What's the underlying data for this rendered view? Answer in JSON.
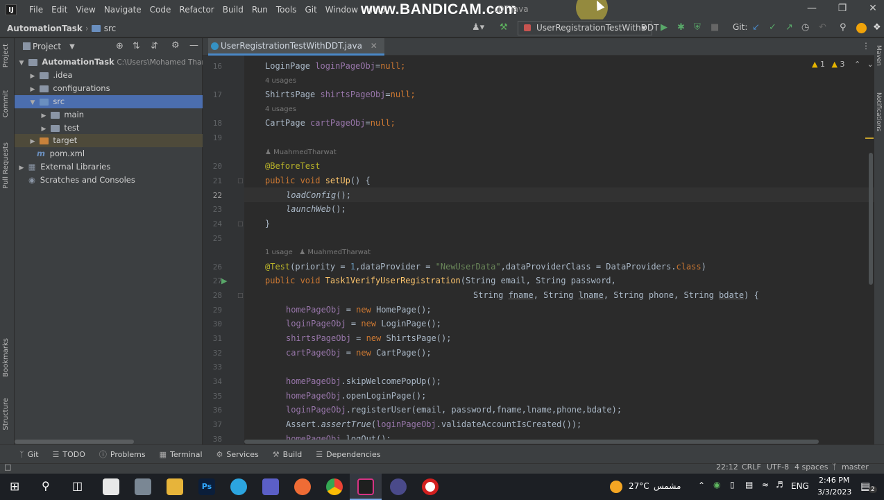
{
  "menubar": {
    "app_icon_label": "IJ",
    "items": [
      "File",
      "Edit",
      "View",
      "Navigate",
      "Code",
      "Refactor",
      "Build",
      "Run",
      "Tools",
      "Git",
      "Window",
      "Help"
    ],
    "watermark": "www.BANDICAM.com",
    "watermark_file": "...DT.java"
  },
  "navbar": {
    "project": "AutomationTask",
    "folder": "src",
    "run_config": "UserRegistrationTestWithDDT",
    "git_label": "Git:"
  },
  "project_panel": {
    "title": "Project",
    "root": "AutomationTask",
    "root_path": "C:\\Users\\Mohamed Tharwat",
    "items": [
      {
        "label": ".idea"
      },
      {
        "label": "configurations"
      },
      {
        "label": "src"
      },
      {
        "label": "main"
      },
      {
        "label": "test"
      },
      {
        "label": "target"
      },
      {
        "label": "pom.xml"
      },
      {
        "label": "External Libraries"
      },
      {
        "label": "Scratches and Consoles"
      }
    ]
  },
  "left_strip": [
    "Project",
    "Commit",
    "Pull Requests",
    "Bookmarks",
    "Structure"
  ],
  "right_strip": [
    "Maven",
    "Notifications"
  ],
  "editor": {
    "tab": "UserRegistrationTestWithDDT.java",
    "warnings": "1",
    "weak_warnings": "3",
    "line_numbers": [
      "16",
      "17",
      "18",
      "19",
      "20",
      "21",
      "22",
      "23",
      "24",
      "25",
      "26",
      "27",
      "28",
      "29",
      "30",
      "31",
      "32",
      "33",
      "34",
      "35",
      "36",
      "37",
      "38"
    ],
    "hints": {
      "usages4": "4 usages",
      "author": "MuahmedTharwat",
      "usage1": "1 usage"
    },
    "code": {
      "l16a": "LoginPage ",
      "l16b": "loginPageObj",
      "l16c": "=",
      "l16d": "null",
      "l16e": ";",
      "l17a": "ShirtsPage ",
      "l17b": "shirtsPageObj",
      "l17c": "=",
      "l17d": "null",
      "l17e": ";",
      "l18a": "CartPage ",
      "l18b": "cartPageObj",
      "l18c": "=",
      "l18d": "null",
      "l18e": ";",
      "l20": "@BeforeTest",
      "l21a": "public void ",
      "l21b": "setUp",
      "l21c": "() {",
      "l22a": "loadConfig",
      "l22b": "();",
      "l23a": "launchWeb",
      "l23b": "();",
      "l24": "}",
      "l26a": "@Test",
      "l26b": "(priority = ",
      "l26c": "1",
      "l26d": ",dataProvider = ",
      "l26e": "\"NewUserData\"",
      "l26f": ",dataProviderClass = DataProviders.",
      "l26g": "class",
      "l26h": ")",
      "l27a": "public void ",
      "l27b": "Task1VerifyUserRegistration",
      "l27c": "(String email, String password,",
      "l28a": "String ",
      "l28b": "fname",
      "l28c": ", String ",
      "l28d": "lname",
      "l28e": ", String phone, String ",
      "l28f": "bdate",
      "l28g": ") {",
      "l29a": "homePageObj",
      "l29b": " = ",
      "l29c": "new ",
      "l29d": "HomePage();",
      "l30a": "loginPageObj",
      "l30b": " = ",
      "l30c": "new ",
      "l30d": "LoginPage();",
      "l31a": "shirtsPageObj",
      "l31b": " = ",
      "l31c": "new ",
      "l31d": "ShirtsPage();",
      "l32a": "cartPageObj",
      "l32b": " = ",
      "l32c": "new ",
      "l32d": "CartPage();",
      "l34a": "homePageObj",
      "l34b": ".skipWelcomePopUp();",
      "l35a": "homePageObj",
      "l35b": ".openLoginPage();",
      "l36a": "loginPageObj",
      "l36b": ".registerUser(email, password,fname,lname,phone,bdate);",
      "l37a": "Assert.",
      "l37b": "assertTrue",
      "l37c": "(",
      "l37d": "loginPageObj",
      "l37e": ".validateAccountIsCreated());",
      "l38a": "homePageObj",
      "l38b": ".logOut();"
    }
  },
  "bottom_tools": [
    "Git",
    "TODO",
    "Problems",
    "Terminal",
    "Services",
    "Build",
    "Dependencies"
  ],
  "status": {
    "position": "22:12",
    "line_sep": "CRLF",
    "encoding": "UTF-8",
    "indent": "4 spaces",
    "branch": "master"
  },
  "taskbar": {
    "weather_temp": "27°C",
    "weather_label": "مشمس",
    "lang": "ENG",
    "time": "2:46 PM",
    "date": "3/3/2023",
    "notif_count": "2",
    "ps_label": "Ps"
  },
  "colors": {
    "keyword": "#cc7832",
    "function": "#ffc66d",
    "field": "#9876aa",
    "string": "#6a8759",
    "annotation": "#bbb529",
    "selection": "#4b6eaf"
  }
}
